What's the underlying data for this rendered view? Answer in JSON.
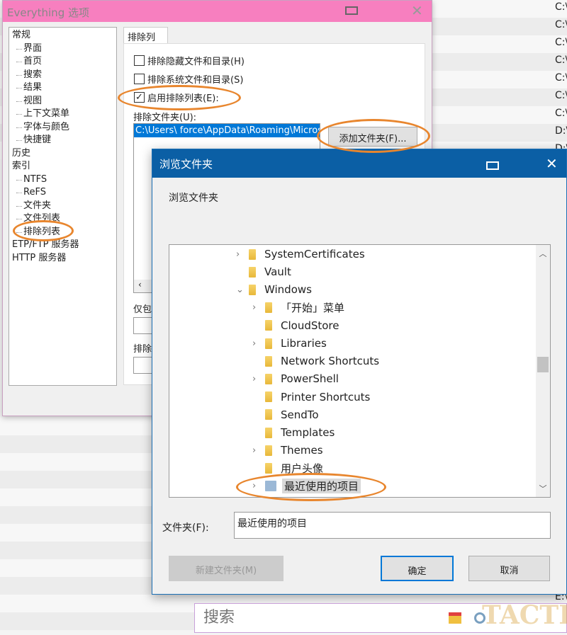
{
  "background_list": {
    "rows": [
      "C:\\",
      "C:\\",
      "C:\\",
      "C:\\",
      "C:\\",
      "C:\\",
      "C:\\",
      "D:\\",
      "D:\\"
    ],
    "bottom_rows": [
      "E:\\",
      "E:\\",
      "F:\\"
    ]
  },
  "options_window": {
    "title": "Everything 选项",
    "tree": [
      {
        "label": "常规",
        "level": 0
      },
      {
        "label": "界面",
        "level": 1
      },
      {
        "label": "首页",
        "level": 1
      },
      {
        "label": "搜索",
        "level": 1
      },
      {
        "label": "结果",
        "level": 1
      },
      {
        "label": "视图",
        "level": 1
      },
      {
        "label": "上下文菜单",
        "level": 1
      },
      {
        "label": "字体与颜色",
        "level": 1
      },
      {
        "label": "快捷键",
        "level": 1
      },
      {
        "label": "历史",
        "level": 0
      },
      {
        "label": "索引",
        "level": 0
      },
      {
        "label": "NTFS",
        "level": 1
      },
      {
        "label": "ReFS",
        "level": 1
      },
      {
        "label": "文件夹",
        "level": 1
      },
      {
        "label": "文件列表",
        "level": 1
      },
      {
        "label": "排除列表",
        "level": 1,
        "selected": true
      },
      {
        "label": "ETP/FTP 服务器",
        "level": 0
      },
      {
        "label": "HTTP 服务器",
        "level": 0
      }
    ],
    "tab": "排除列表",
    "checkboxes": [
      {
        "label": "排除隐藏文件和目录(H)",
        "checked": false
      },
      {
        "label": "排除系统文件和目录(S)",
        "checked": false
      },
      {
        "label": "启用排除列表(E):",
        "checked": true
      }
    ],
    "exclude_folders_label": "排除文件夹(U):",
    "exclude_folders": [
      "C:\\Users\\ force\\AppData\\Roaming\\Microso"
    ],
    "add_folder_button": "添加文件夹(F)...",
    "include_only_label": "仅包",
    "exclude_files_label": "排除"
  },
  "browse_dialog": {
    "title": "浏览文件夹",
    "heading": "浏览文件夹",
    "folders": [
      {
        "label": "SystemCertificates",
        "indent": 0,
        "expander": "collapsed"
      },
      {
        "label": "Vault",
        "indent": 0,
        "expander": "none"
      },
      {
        "label": "Windows",
        "indent": 0,
        "expander": "expanded"
      },
      {
        "label": "「开始」菜单",
        "indent": 1,
        "expander": "collapsed"
      },
      {
        "label": "CloudStore",
        "indent": 1,
        "expander": "none"
      },
      {
        "label": "Libraries",
        "indent": 1,
        "expander": "collapsed"
      },
      {
        "label": "Network Shortcuts",
        "indent": 1,
        "expander": "none"
      },
      {
        "label": "PowerShell",
        "indent": 1,
        "expander": "collapsed"
      },
      {
        "label": "Printer Shortcuts",
        "indent": 1,
        "expander": "none"
      },
      {
        "label": "SendTo",
        "indent": 1,
        "expander": "none"
      },
      {
        "label": "Templates",
        "indent": 1,
        "expander": "none"
      },
      {
        "label": "Themes",
        "indent": 1,
        "expander": "collapsed"
      },
      {
        "label": "用户头像",
        "indent": 1,
        "expander": "none"
      },
      {
        "label": "最近使用的项目",
        "indent": 1,
        "expander": "collapsed",
        "selected": true,
        "icon": "recent-items-icon"
      }
    ],
    "folder_label": "文件夹(F):",
    "folder_value": "最近使用的项目",
    "new_folder_button": "新建文件夹(M)",
    "ok_button": "确定",
    "cancel_button": "取消"
  },
  "search": {
    "placeholder": "搜索"
  },
  "watermark": "TACTI",
  "colors": {
    "options_titlebar": "#f77fbf",
    "dialog_titlebar": "#0b5fa5",
    "selection": "#0078d7",
    "annotation": "#e8862e"
  }
}
